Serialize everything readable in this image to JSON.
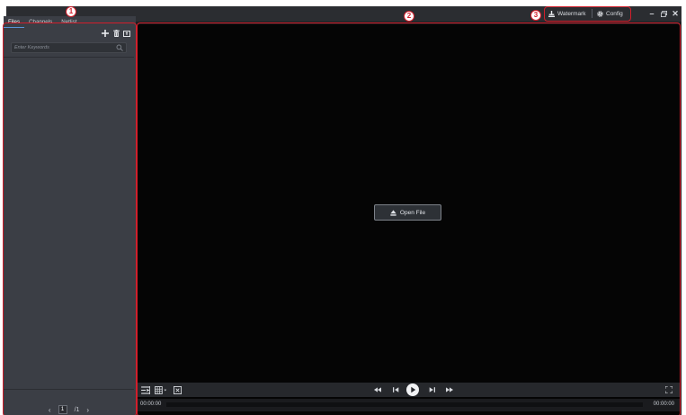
{
  "badges": {
    "left_panel": "1",
    "viewer": "2",
    "title_tools": "3"
  },
  "titlebar": {
    "watermark_label": "Watermark",
    "config_label": "Config",
    "minimize_icon": "minimize-icon",
    "restore_icon": "restore-icon",
    "close_icon": "close-icon"
  },
  "left_panel": {
    "tabs": [
      {
        "label": "Files",
        "active": true
      },
      {
        "label": "Channels",
        "active": false
      },
      {
        "label": "Netlist",
        "active": false
      }
    ],
    "tools": [
      "add-icon",
      "delete-icon",
      "import-icon"
    ],
    "search": {
      "placeholder": "Enter Keywords",
      "value": ""
    },
    "pager": {
      "prev": "‹",
      "current_page": "1",
      "total": "/1",
      "next": "›"
    }
  },
  "viewer": {
    "open_file_label": "Open File",
    "controls_left": [
      "playlist-icon",
      "layout-grid-icon",
      "close-window-icon"
    ],
    "controls_center": [
      "rewind-icon",
      "step-back-icon",
      "play-icon",
      "step-forward-icon",
      "fast-forward-icon"
    ],
    "controls_right": [
      "fullscreen-icon"
    ],
    "time_start": "00:00:00",
    "time_end": "00:00:00"
  },
  "colors": {
    "accent_red": "#d21e2b",
    "panel": "#3b3e45",
    "viewer_bg": "#050505"
  }
}
